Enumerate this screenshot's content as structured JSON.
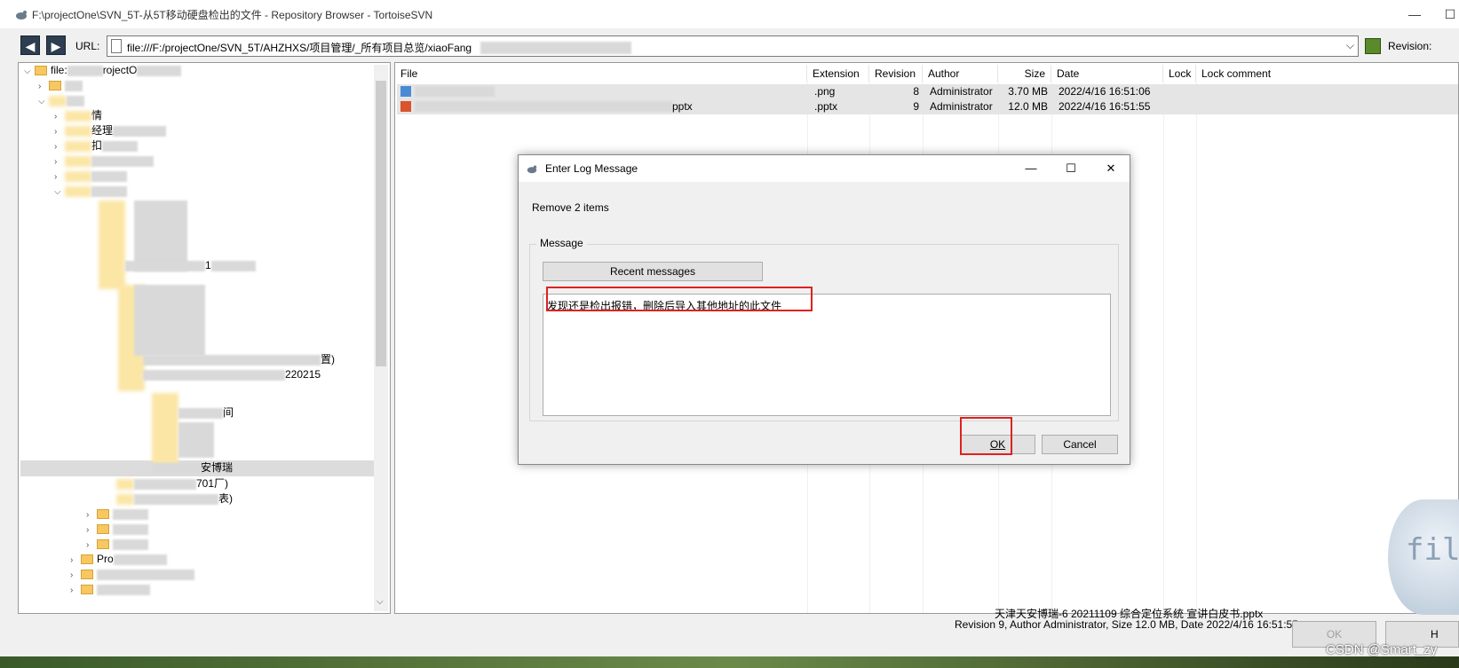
{
  "window": {
    "title": "F:\\projectOne\\SVN_5T-从5T移动硬盘检出的文件 - Repository Browser - TortoiseSVN",
    "minimize": "—",
    "maximize": "☐"
  },
  "urlbar": {
    "label": "URL:",
    "value": "file:///F:/projectOne/SVN_5T/AHZHXS/项目管理/_所有项目总览/xiaoFang",
    "revision_label": "Revision:"
  },
  "tree": {
    "root_label": "file:",
    "root_suffix": "rojectO",
    "items": [
      {
        "text": "情"
      },
      {
        "text": "经理"
      },
      {
        "text": "扣"
      },
      {
        "text": "1"
      },
      {
        "text": "置)"
      },
      {
        "text": "220215"
      },
      {
        "text": "间"
      },
      {
        "text": "安博瑞"
      },
      {
        "text": "701厂)"
      },
      {
        "text": "表)"
      },
      {
        "text": "Pro"
      }
    ]
  },
  "filelist": {
    "headers": [
      "File",
      "Extension",
      "Revision",
      "Author",
      "Size",
      "Date",
      "Lock",
      "Lock comment"
    ],
    "rows": [
      {
        "file": "",
        "ext": ".png",
        "rev": "8",
        "author": "Administrator",
        "size": "3.70 MB",
        "date": "2022/4/16 16:51:06"
      },
      {
        "file": "pptx",
        "ext": ".pptx",
        "rev": "9",
        "author": "Administrator",
        "size": "12.0 MB",
        "date": "2022/4/16 16:51:55"
      }
    ]
  },
  "status": {
    "filename": "天津天安博瑞-6 20211109 综合定位系统 宣讲白皮书.pptx",
    "info": "Revision 9, Author Administrator, Size 12.0 MB, Date 2022/4/16 16:51:55",
    "ok_label": "OK",
    "h_label": "H"
  },
  "dialog": {
    "title": "Enter Log Message",
    "remove_text": "Remove 2 items",
    "group_label": "Message",
    "recent_label": "Recent messages",
    "message": "发现还是检出报错，删除后导入其他地址的此文件",
    "ok_label": "OK",
    "cancel_label": "Cancel"
  },
  "watermark": {
    "csdn": "CSDN @Smart_zy",
    "globe_text": "fil"
  },
  "colors": {
    "highlight_red": "#e02020",
    "folder_yellow": "#f6c85f"
  }
}
